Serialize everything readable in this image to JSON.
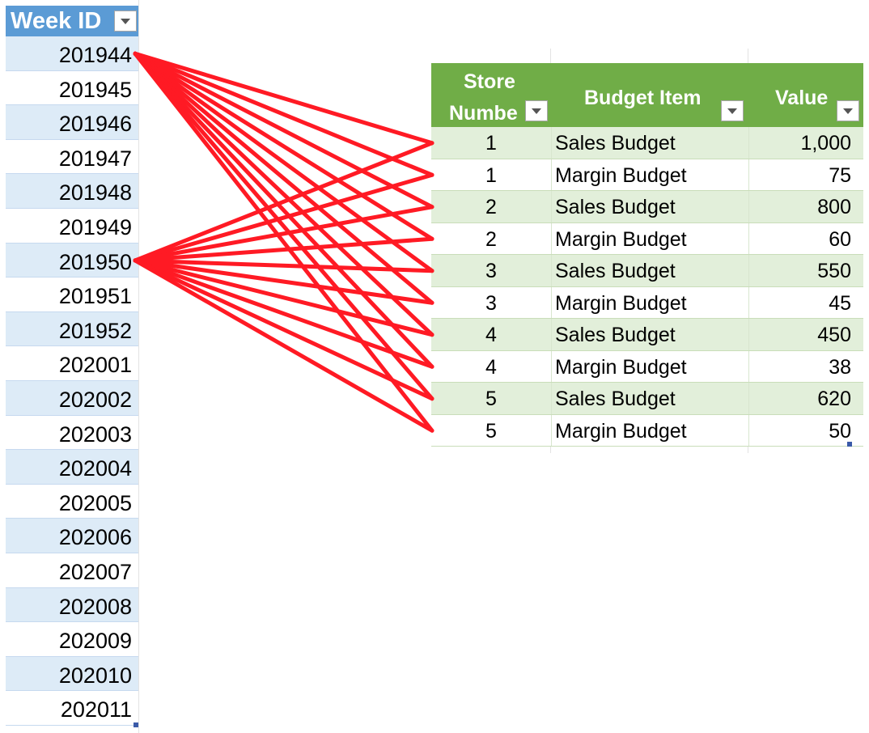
{
  "week_table": {
    "header": "Week ID",
    "rows": [
      "201944",
      "201945",
      "201946",
      "201947",
      "201948",
      "201949",
      "201950",
      "201951",
      "201952",
      "202001",
      "202002",
      "202003",
      "202004",
      "202005",
      "202006",
      "202007",
      "202008",
      "202009",
      "202010",
      "202011"
    ]
  },
  "budget_table": {
    "headers": {
      "store_line1": "Store",
      "store_line2": "Numbe",
      "budget_item": "Budget Item",
      "value": "Value"
    },
    "rows": [
      {
        "store": "1",
        "item": "Sales Budget",
        "value": "1,000"
      },
      {
        "store": "1",
        "item": "Margin Budget",
        "value": "75"
      },
      {
        "store": "2",
        "item": "Sales Budget",
        "value": "800"
      },
      {
        "store": "2",
        "item": "Margin Budget",
        "value": "60"
      },
      {
        "store": "3",
        "item": "Sales Budget",
        "value": "550"
      },
      {
        "store": "3",
        "item": "Margin Budget",
        "value": "45"
      },
      {
        "store": "4",
        "item": "Sales Budget",
        "value": "450"
      },
      {
        "store": "4",
        "item": "Margin Budget",
        "value": "38"
      },
      {
        "store": "5",
        "item": "Sales Budget",
        "value": "620"
      },
      {
        "store": "5",
        "item": "Margin Budget",
        "value": "50"
      }
    ]
  },
  "connectors": {
    "color": "#ff1a24",
    "from_weeks": [
      "201944",
      "201950"
    ],
    "to": "all budget rows"
  },
  "colors": {
    "week_header": "#5b9bd5",
    "week_band": "#ddebf7",
    "budget_header": "#70ad47",
    "budget_band": "#e2efda"
  }
}
